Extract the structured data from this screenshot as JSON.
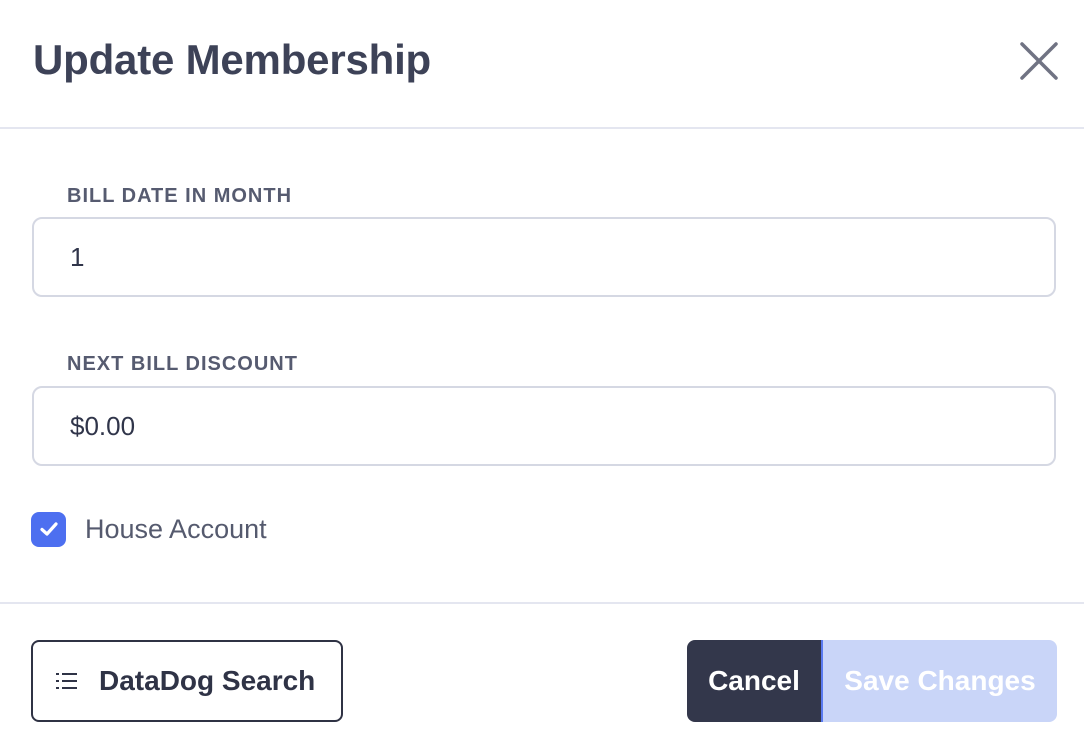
{
  "dialog": {
    "title": "Update Membership",
    "close_icon": "close-icon"
  },
  "fields": {
    "bill_date": {
      "label": "BILL DATE IN MONTH",
      "value": "1"
    },
    "next_bill_discount": {
      "label": "NEXT BILL DISCOUNT",
      "value": "$0.00"
    }
  },
  "house_account": {
    "label": "House Account",
    "checked": true
  },
  "footer": {
    "datadog_label": "DataDog Search",
    "datadog_icon": "list-icon",
    "cancel_label": "Cancel",
    "save_label": "Save Changes",
    "save_disabled": true
  },
  "colors": {
    "accent": "#4d6ff0",
    "cancel_bg": "#33374b",
    "save_disabled_bg": "#c9d5f8",
    "title": "#3d4257"
  }
}
